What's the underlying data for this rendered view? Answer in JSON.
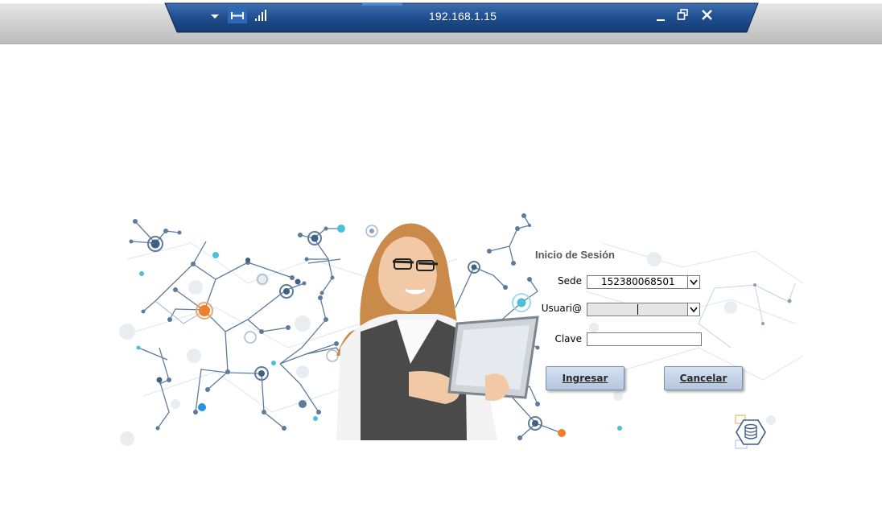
{
  "connection_bar": {
    "host": "192.168.1.15",
    "icons": [
      "dropdown-arrow-icon",
      "pin-icon",
      "signal-strength-icon",
      "minimize-icon",
      "restore-icon",
      "close-icon"
    ]
  },
  "login": {
    "title": "Inicio de Sesión",
    "sede_label": "Sede",
    "sede_value": "152380068501",
    "usuario_label": "Usuari@",
    "usuario_value": "",
    "clave_label": "Clave",
    "clave_value": "",
    "ingresar_label": "Ingresar",
    "cancelar_label": "Cancelar",
    "logo_icon": "database-hexagon-icon"
  },
  "colors": {
    "bar_blue": "#1f4e8f",
    "button_fill": "#c5d4e8",
    "node_blue": "#4a6f9a",
    "node_orange": "#f07f2b",
    "node_cyan": "#4bc0d9"
  }
}
